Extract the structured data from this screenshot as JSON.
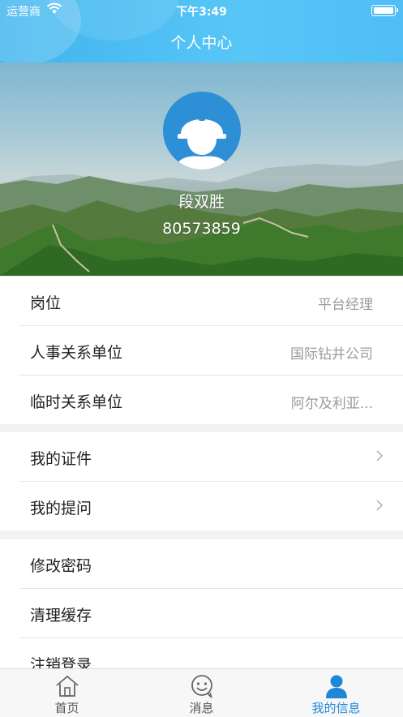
{
  "status_bar": {
    "carrier": "运营商",
    "time": "下午3:49"
  },
  "header": {
    "title": "个人中心"
  },
  "profile": {
    "name": "段双胜",
    "id": "80573859"
  },
  "info_rows": [
    {
      "label": "岗位",
      "value": "平台经理"
    },
    {
      "label": "人事关系单位",
      "value": "国际钻井公司"
    },
    {
      "label": "临时关系单位",
      "value": "阿尔及利亚..."
    }
  ],
  "link_rows": [
    {
      "label": "我的证件"
    },
    {
      "label": "我的提问"
    }
  ],
  "action_rows": [
    {
      "label": "修改密码"
    },
    {
      "label": "清理缓存"
    },
    {
      "label": "注销登录"
    }
  ],
  "tabbar": [
    {
      "label": "首页",
      "icon": "home-icon",
      "active": false
    },
    {
      "label": "消息",
      "icon": "message-icon",
      "active": false
    },
    {
      "label": "我的信息",
      "icon": "user-icon",
      "active": true
    }
  ],
  "colors": {
    "header": "#4fbef4",
    "active_tab": "#1e88d8",
    "avatar_bg": "#2d8fd6"
  }
}
